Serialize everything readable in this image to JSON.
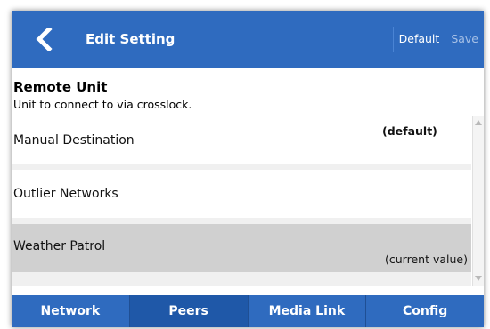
{
  "header": {
    "title": "Edit Setting",
    "back_icon": "chevron-left-icon",
    "default_label": "Default",
    "save_label": "Save"
  },
  "setting": {
    "title": "Remote Unit",
    "description": "Unit to connect to via crosslock."
  },
  "options": [
    {
      "label": "Manual Destination",
      "note": "(default)"
    },
    {
      "label": "Outlier Networks",
      "note": ""
    },
    {
      "label": "Weather Patrol",
      "note": "(current value)",
      "selected": true
    }
  ],
  "tabs": [
    {
      "label": "Network"
    },
    {
      "label": "Peers",
      "active": true
    },
    {
      "label": "Media Link"
    },
    {
      "label": "Config"
    }
  ],
  "colors": {
    "bar": "#2f6bbf",
    "selected_row": "#d0d0d0",
    "disabled_action": "#a6c0e6"
  }
}
